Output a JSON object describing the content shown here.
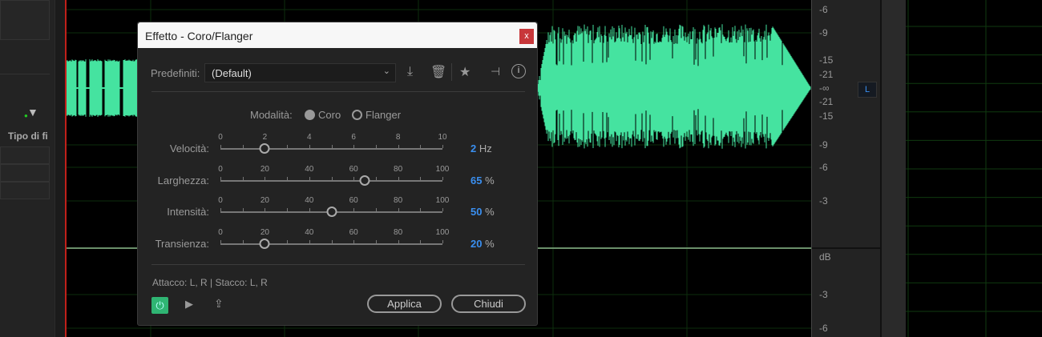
{
  "left_panel": {
    "filter_label": "Tipo di fi"
  },
  "ruler": {
    "top_labels": [
      "-6",
      "-9",
      "-15",
      "-21",
      "-∞",
      "-21",
      "-15",
      "-9",
      "-6",
      "-3"
    ],
    "unit": "dB",
    "bottom_labels": [
      "-3",
      "-6"
    ],
    "channel": "L"
  },
  "colors": {
    "waveform": "#45e3a0",
    "accent": "#3a8ff0",
    "close": "#c8373a",
    "power": "#2fb573"
  },
  "dialog": {
    "title": "Effetto - Coro/Flanger",
    "close_label": "x",
    "preset_label": "Predefiniti:",
    "preset_value": "(Default)",
    "mode_label": "Modalità:",
    "modes": [
      {
        "label": "Coro",
        "selected": true
      },
      {
        "label": "Flanger",
        "selected": false
      }
    ],
    "sliders": [
      {
        "label": "Velocità:",
        "min": 0,
        "max": 10,
        "ticks": [
          "0",
          "2",
          "4",
          "6",
          "8",
          "10"
        ],
        "value": 2,
        "value_text": "2",
        "unit": "Hz"
      },
      {
        "label": "Larghezza:",
        "min": 0,
        "max": 100,
        "ticks": [
          "0",
          "20",
          "40",
          "60",
          "80",
          "100"
        ],
        "value": 65,
        "value_text": "65",
        "unit": "%"
      },
      {
        "label": "Intensità:",
        "min": 0,
        "max": 100,
        "ticks": [
          "0",
          "20",
          "40",
          "60",
          "80",
          "100"
        ],
        "value": 50,
        "value_text": "50",
        "unit": "%"
      },
      {
        "label": "Transienza:",
        "min": 0,
        "max": 100,
        "ticks": [
          "0",
          "20",
          "40",
          "60",
          "80",
          "100"
        ],
        "value": 20,
        "value_text": "20",
        "unit": "%"
      }
    ],
    "routing": "Attacco: L, R | Stacco: L, R",
    "apply_label": "Applica",
    "close_button_label": "Chiudi"
  }
}
